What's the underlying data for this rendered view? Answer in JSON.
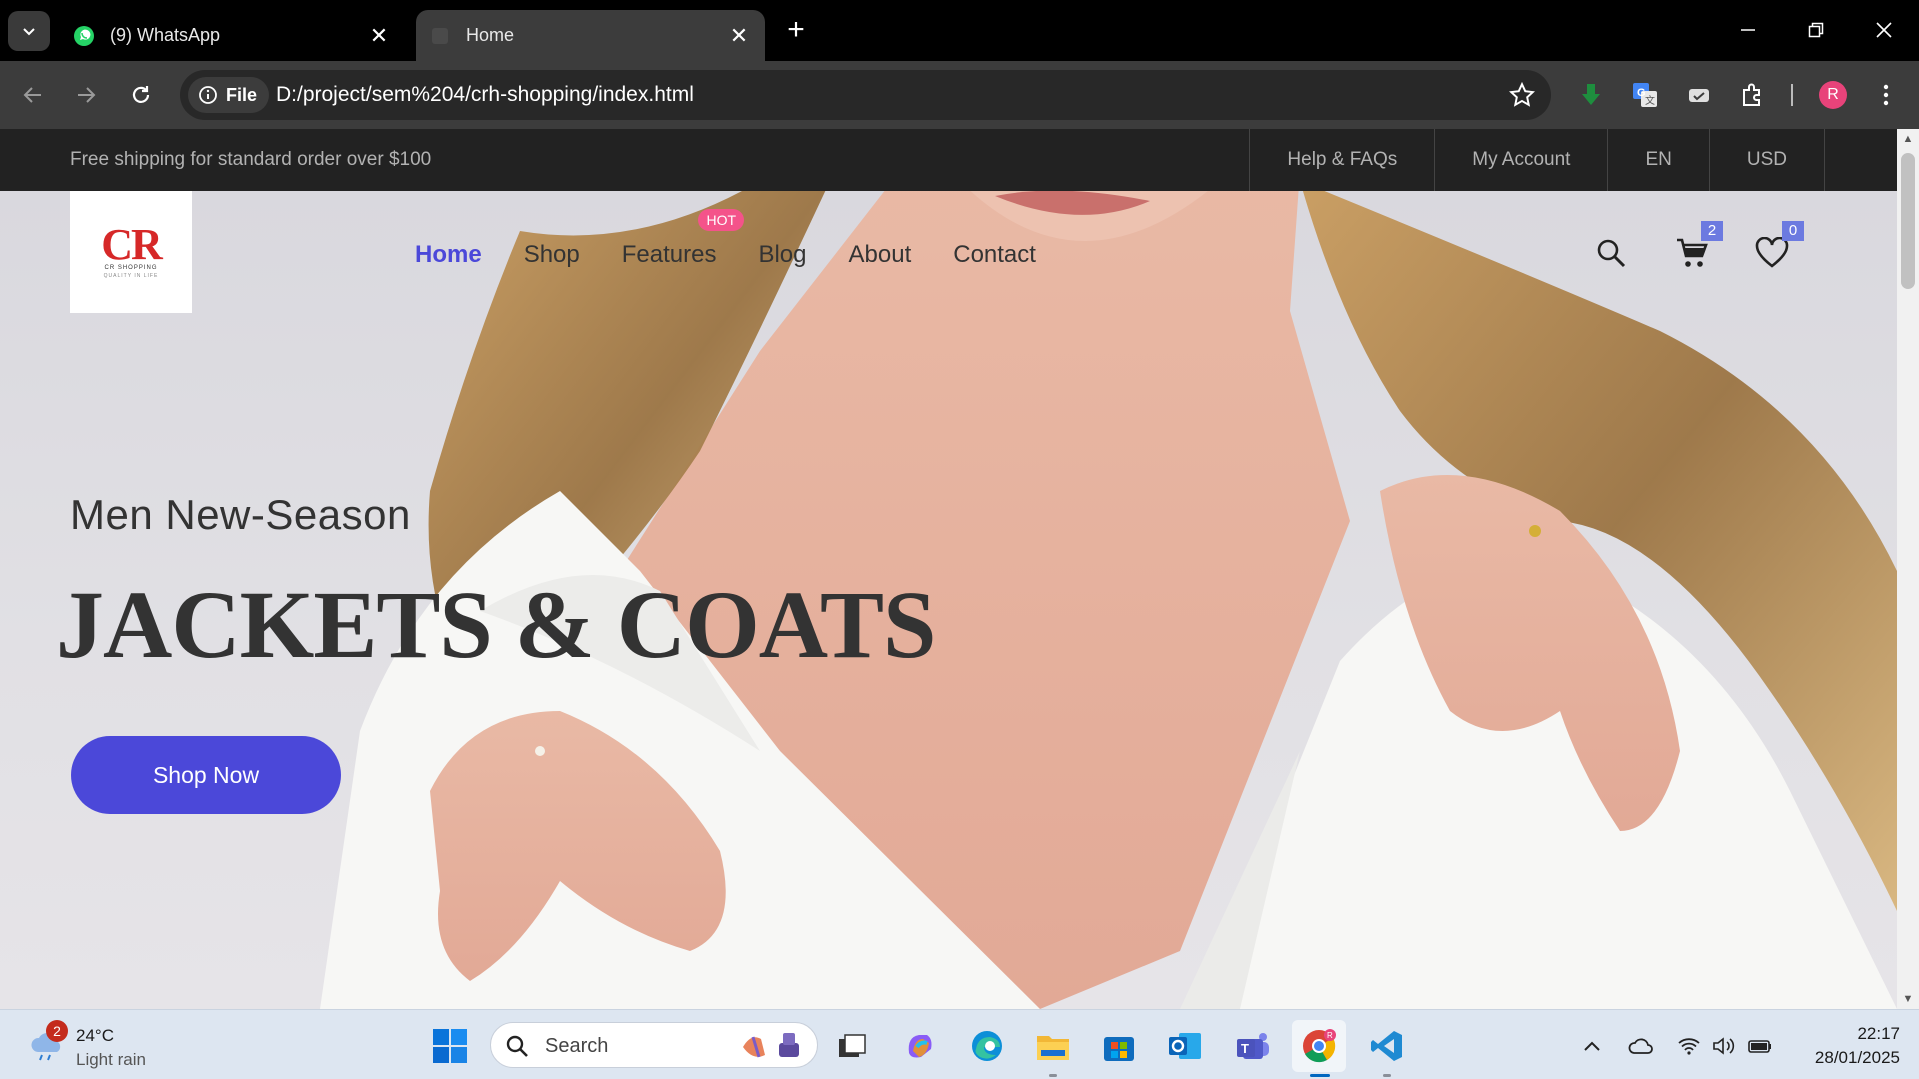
{
  "browser": {
    "tabs": [
      {
        "title": "(9) WhatsApp",
        "icon": "whatsapp-icon",
        "active": false
      },
      {
        "title": "Home",
        "icon": "page-icon",
        "active": true
      }
    ],
    "chip_label": "File",
    "url": "D:/project/sem%204/crh-shopping/index.html",
    "profile_initial": "R"
  },
  "site": {
    "topbar": {
      "shipping_text": "Free shipping for standard order over $100",
      "links": [
        "Help & FAQs",
        "My Account",
        "EN",
        "USD"
      ]
    },
    "logo": {
      "text": "CR",
      "sub": "CR SHOPPING",
      "tagline": "QUALITY IN LIFE"
    },
    "nav": {
      "items": [
        "Home",
        "Shop",
        "Features",
        "Blog",
        "About",
        "Contact"
      ],
      "active": "Home",
      "hot_label": "HOT"
    },
    "header_icons": {
      "cart_count": "2",
      "wishlist_count": "0"
    },
    "hero": {
      "subtitle": "Men New-Season",
      "headline": "JACKETS & COATS",
      "cta": "Shop Now"
    },
    "colors": {
      "accent": "#4b48d9",
      "hot": "#f4538a",
      "badge": "#6c7ae0",
      "topbar": "#222222"
    }
  },
  "taskbar": {
    "weather": {
      "temp": "24°C",
      "condition": "Light rain",
      "badge": "2"
    },
    "search_placeholder": "Search",
    "apps": [
      "file-explorer-blank-icon",
      "copilot-icon",
      "edge-icon",
      "file-explorer-icon",
      "store-icon",
      "outlook-icon",
      "teams-icon",
      "chrome-icon",
      "vscode-icon"
    ],
    "clock": {
      "time": "22:17",
      "date": "28/01/2025"
    }
  }
}
